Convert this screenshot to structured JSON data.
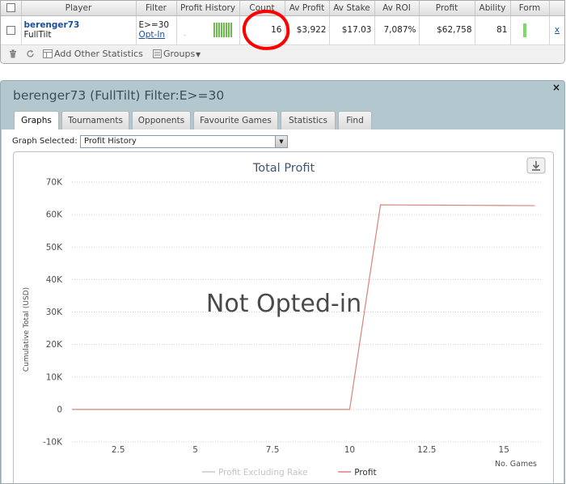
{
  "table": {
    "headers": [
      "",
      "Player",
      "Filter",
      "Profit History",
      "Count",
      "Av Profit",
      "Av Stake",
      "Av ROI",
      "Profit",
      "Ability",
      "Form",
      ""
    ],
    "row": {
      "player_name": "berenger73",
      "site": "FullTilt",
      "filter": "E>=30",
      "filter_link": "Opt-In",
      "count": "16",
      "av_profit": "$3,922",
      "av_stake": "$17.03",
      "av_roi": "7,087%",
      "profit": "$62,758",
      "ability": "81",
      "remove": "x"
    }
  },
  "toolbar": {
    "add_stats": "Add Other Statistics",
    "groups": "Groups"
  },
  "dialog": {
    "title": "berenger73 (FullTilt) Filter:E>=30",
    "close": "×",
    "tabs": [
      "Graphs",
      "Tournaments",
      "Opponents",
      "Favourite Games",
      "Statistics",
      "Find"
    ],
    "active_tab": "Graphs",
    "graph_selected_label": "Graph Selected:",
    "graph_selected_value": "Profit History"
  },
  "chart_data": {
    "type": "line",
    "title": "Total Profit",
    "xlabel": "No. Games",
    "ylabel": "Cumulative Total (USD)",
    "overlay_text": "Not Opted-in",
    "xlim": [
      1,
      16.2
    ],
    "ylim": [
      -10000,
      70000
    ],
    "x_ticks": [
      2.5,
      5,
      7.5,
      10,
      12.5,
      15
    ],
    "x_tick_labels": [
      "2.5",
      "5",
      "7.5",
      "10",
      "12.5",
      "15"
    ],
    "y_ticks": [
      -10000,
      0,
      10000,
      20000,
      30000,
      40000,
      50000,
      60000,
      70000
    ],
    "y_tick_labels": [
      "-10K",
      "0",
      "10K",
      "20K",
      "30K",
      "40K",
      "50K",
      "60K",
      "70K"
    ],
    "grid": "horizontal dotted",
    "legend_position": "bottom",
    "series": [
      {
        "name": "Profit Excluding Rake",
        "color": "#c8c8c8",
        "x": [],
        "values": []
      },
      {
        "name": "Profit",
        "color": "#d58479",
        "x": [
          1,
          2,
          3,
          4,
          5,
          6,
          7,
          8,
          9,
          10,
          11,
          12,
          13,
          14,
          15,
          16
        ],
        "values": [
          0,
          0,
          0,
          0,
          0,
          0,
          0,
          0,
          0,
          0,
          63000,
          62950,
          62900,
          62850,
          62800,
          62758
        ]
      }
    ]
  }
}
